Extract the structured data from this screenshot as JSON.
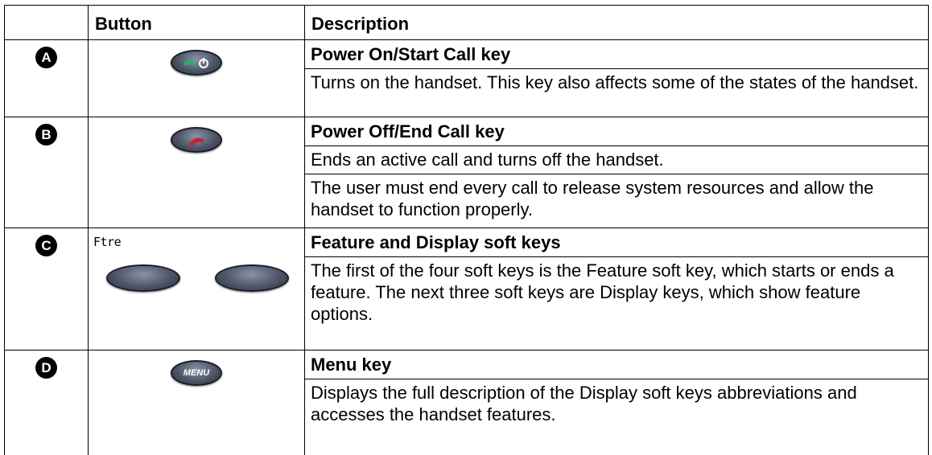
{
  "header": {
    "col1": "",
    "col2": "Button",
    "col3": "Description"
  },
  "rows": [
    {
      "badge": "A",
      "icon": "power-on-start-call-icon",
      "title": "Power On/Start Call key",
      "paras": [
        "Turns on the handset. This key also affects some of the states of the handset."
      ]
    },
    {
      "badge": "B",
      "icon": "power-off-end-call-icon",
      "title": "Power Off/End Call key",
      "paras": [
        "Ends an active call and turns off the handset.",
        "The user must end every call to release system resources and allow the handset to function properly."
      ]
    },
    {
      "badge": "C",
      "display_text": "Ftre",
      "icon": "soft-keys-icon",
      "title": "Feature and Display soft keys",
      "paras": [
        "The first of the four soft keys is the Feature soft key, which starts or ends a feature. The next three soft keys are Display keys, which show feature options."
      ]
    },
    {
      "badge": "D",
      "icon": "menu-key-icon",
      "key_label": "MENU",
      "title": "Menu key",
      "paras": [
        "Displays the full description of the Display soft keys abbreviations and accesses the handset features."
      ]
    }
  ],
  "colors": {
    "start_call": "#27b36a",
    "end_call": "#c8203a",
    "key_body": "#4e5568"
  }
}
